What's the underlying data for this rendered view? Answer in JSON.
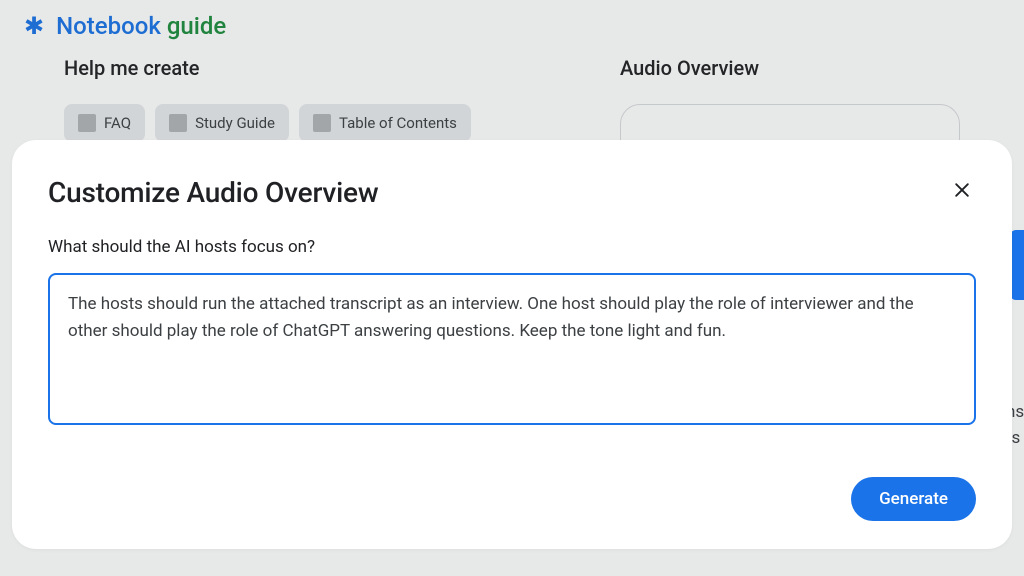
{
  "header": {
    "title_word_1": "Notebook",
    "title_word_2": "guide"
  },
  "background": {
    "help_me_create_label": "Help me create",
    "audio_overview_label": "Audio Overview",
    "chips": [
      {
        "label": "FAQ"
      },
      {
        "label": "Study Guide"
      },
      {
        "label": "Table of Contents"
      }
    ]
  },
  "modal": {
    "title": "Customize Audio Overview",
    "prompt_label": "What should the AI hosts focus on?",
    "textarea_value": "The hosts should run the attached transcript as an interview. One host should play the role of interviewer and the other should play the role of ChatGPT answering questions. Keep the tone light and fun.",
    "generate_label": "Generate"
  },
  "peek": {
    "line1": "ns",
    "line2": "ts"
  }
}
